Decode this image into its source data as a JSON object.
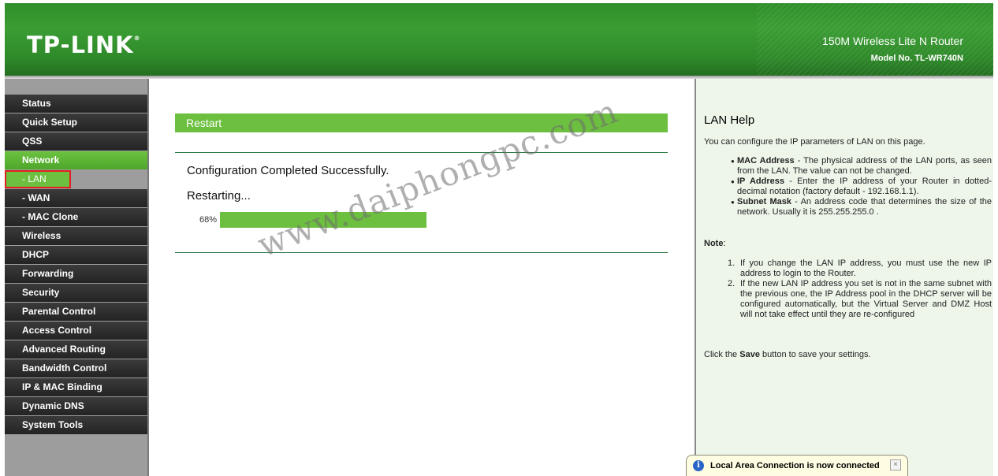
{
  "header": {
    "logo": "TP-LINK",
    "logo_mark": "®",
    "product": "150M Wireless Lite N Router",
    "model": "Model No. TL-WR740N"
  },
  "sidebar": {
    "items": [
      {
        "label": "Status"
      },
      {
        "label": "Quick Setup"
      },
      {
        "label": "QSS"
      },
      {
        "label": "Network"
      },
      {
        "label": "- LAN"
      },
      {
        "label": "- WAN"
      },
      {
        "label": "- MAC Clone"
      },
      {
        "label": "Wireless"
      },
      {
        "label": "DHCP"
      },
      {
        "label": "Forwarding"
      },
      {
        "label": "Security"
      },
      {
        "label": "Parental Control"
      },
      {
        "label": "Access Control"
      },
      {
        "label": "Advanced Routing"
      },
      {
        "label": "Bandwidth Control"
      },
      {
        "label": "IP & MAC Binding"
      },
      {
        "label": "Dynamic DNS"
      },
      {
        "label": "System Tools"
      }
    ]
  },
  "main": {
    "title": "Restart",
    "message1": "Configuration Completed Successfully.",
    "message2": "Restarting...",
    "progress_label": "68%",
    "progress_value": 68
  },
  "watermark": "www.daiphongpc.com",
  "help": {
    "title": "LAN Help",
    "intro": "You can configure the IP parameters of LAN on this page.",
    "bullets": [
      {
        "term": "MAC Address",
        "text": " - The physical address of the LAN ports, as seen from the LAN. The value can not be changed."
      },
      {
        "term": "IP Address",
        "text": " - Enter the IP address of your Router in dotted-decimal notation (factory default - 192.168.1.1)."
      },
      {
        "term": "Subnet Mask",
        "text": " - An address code that determines the size of the network. Usually it is 255.255.255.0 ."
      }
    ],
    "note_label": "Note",
    "note_colon": ":",
    "notes": [
      {
        "num": "1.",
        "text": "If you change the LAN IP address, you must use the new IP address to login to the Router."
      },
      {
        "num": "2.",
        "text": "If the new LAN IP address you set is not in the same subnet with the previous one, the IP Address pool in the DHCP server will be configured automatically, but the Virtual Server and DMZ Host will not take effect until they are re-configured"
      }
    ],
    "save_prefix": "Click the ",
    "save_word": "Save",
    "save_suffix": " button to save your settings."
  },
  "notification": {
    "text": "Local Area Connection is now connected",
    "icon": "info-icon",
    "close": "×"
  }
}
